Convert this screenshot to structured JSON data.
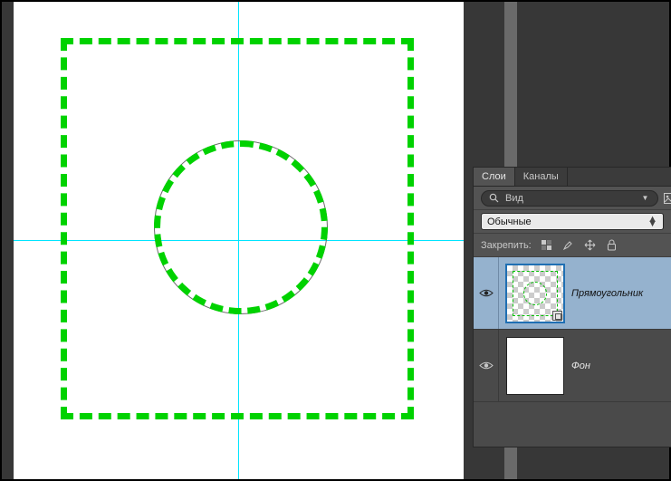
{
  "tabs": {
    "layers": "Слои",
    "channels": "Каналы"
  },
  "search": {
    "placeholder": "Вид"
  },
  "blend_mode": "Обычные",
  "lock_label": "Закрепить:",
  "layer_names": {
    "rect": "Прямоугольник",
    "bg": "Фон"
  }
}
